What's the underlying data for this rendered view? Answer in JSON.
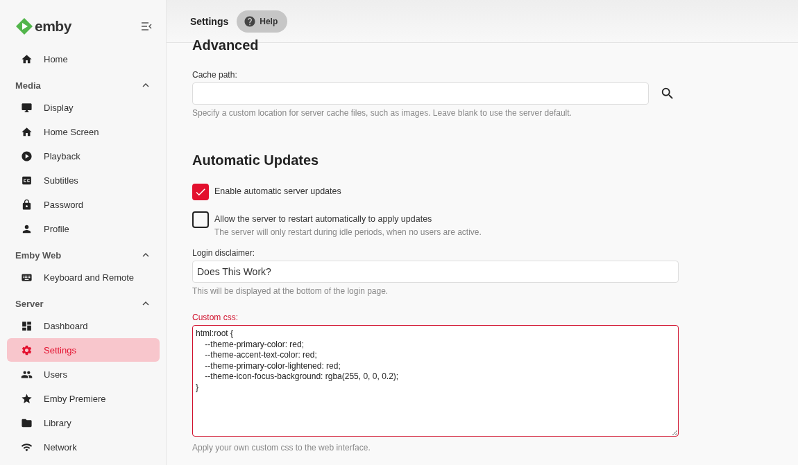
{
  "sidebar": {
    "logo": "emby",
    "groups": [
      {
        "items": [
          {
            "label": "Home",
            "selected": false
          }
        ]
      },
      {
        "title": "Media",
        "expanded": true,
        "items": [
          {
            "label": "Display",
            "selected": false
          },
          {
            "label": "Home Screen",
            "selected": false
          },
          {
            "label": "Playback",
            "selected": false
          },
          {
            "label": "Subtitles",
            "selected": false
          },
          {
            "label": "Password",
            "selected": false
          },
          {
            "label": "Profile",
            "selected": false
          }
        ]
      },
      {
        "title": "Emby Web",
        "expanded": true,
        "items": [
          {
            "label": "Keyboard and Remote",
            "selected": false
          }
        ]
      },
      {
        "title": "Server",
        "expanded": true,
        "items": [
          {
            "label": "Dashboard",
            "selected": false
          },
          {
            "label": "Settings",
            "selected": true
          },
          {
            "label": "Users",
            "selected": false
          },
          {
            "label": "Emby Premiere",
            "selected": false
          },
          {
            "label": "Library",
            "selected": false
          },
          {
            "label": "Network",
            "selected": false
          }
        ]
      }
    ]
  },
  "header": {
    "title": "Settings",
    "help_button": "Help"
  },
  "sections": [
    {
      "heading": "Advanced",
      "fields": [
        {
          "kind": "path",
          "label": "Cache path:",
          "help": "Specify a custom location for server cache files, such as images. Leave blank to use the server default."
        }
      ]
    },
    {
      "heading": "Automatic Updates",
      "fields": [
        {
          "kind": "checkbox",
          "label": "Enable automatic server updates",
          "checked": true
        },
        {
          "kind": "checkbox",
          "label": "Allow the server to restart automatically to apply updates",
          "checked": false,
          "help": "The server will only restart during idle periods, when no users are active."
        },
        {
          "kind": "text",
          "label": "Login disclaimer:",
          "value": "Does This Work?",
          "help": "This will be displayed at the bottom of the login page."
        },
        {
          "kind": "textarea",
          "label": "Custom css:",
          "focused": true,
          "lines": [
            "html:root {",
            "    --theme-primary-color: red;",
            "    --theme-accent-text-color: red;",
            "    --theme-primary-color-lightened: red;",
            "    --theme-icon-focus-background: rgba(255, 0, 0, 0.2);",
            "}"
          ],
          "help": "Apply your own custom css to the web interface."
        }
      ]
    }
  ]
}
